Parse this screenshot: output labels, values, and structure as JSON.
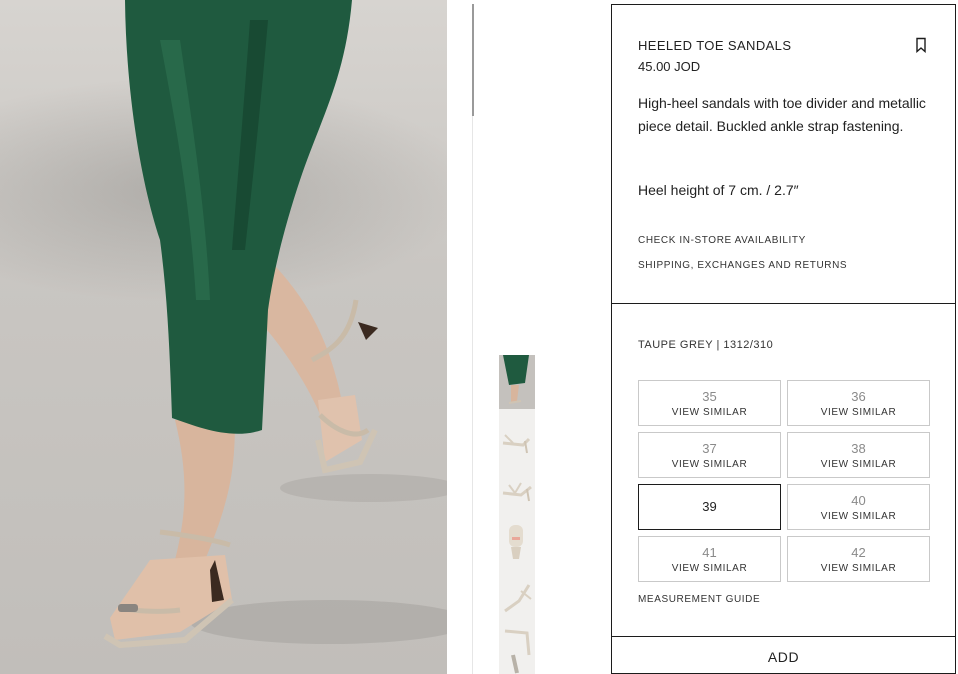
{
  "product": {
    "title": "HEELED TOE SANDALS",
    "price": "45.00 JOD",
    "description": "High-heel sandals with toe divider and metallic piece detail. Buckled ankle strap fastening.",
    "heel_height": "Heel height of 7 cm. / 2.7″",
    "links": {
      "store_availability": "CHECK IN-STORE AVAILABILITY",
      "shipping": "SHIPPING, EXCHANGES AND RETURNS"
    },
    "bookmark_icon": "bookmark-icon"
  },
  "variant": {
    "color_ref": "TAUPE GREY | 1312/310"
  },
  "sizes": [
    {
      "size": "35",
      "note": "VIEW SIMILAR",
      "available": false
    },
    {
      "size": "36",
      "note": "VIEW SIMILAR",
      "available": false
    },
    {
      "size": "37",
      "note": "VIEW SIMILAR",
      "available": false
    },
    {
      "size": "38",
      "note": "VIEW SIMILAR",
      "available": false
    },
    {
      "size": "39",
      "note": "",
      "available": true
    },
    {
      "size": "40",
      "note": "VIEW SIMILAR",
      "available": false
    },
    {
      "size": "41",
      "note": "VIEW SIMILAR",
      "available": false
    },
    {
      "size": "42",
      "note": "VIEW SIMILAR",
      "available": false
    }
  ],
  "measurement_guide": "MEASUREMENT GUIDE",
  "add_button": "ADD",
  "thumbnails": [
    "model-legs-thumb",
    "sandal-side-thumb",
    "sandal-angle-thumb",
    "sandal-front-thumb",
    "sandal-top-thumb",
    "sandal-heel-thumb"
  ],
  "colors": {
    "dress_green": "#1f5a3f",
    "sandal_taupe": "#cfc4b4",
    "floor_grey": "#c9c6c2",
    "border": "#1c1c1c"
  }
}
